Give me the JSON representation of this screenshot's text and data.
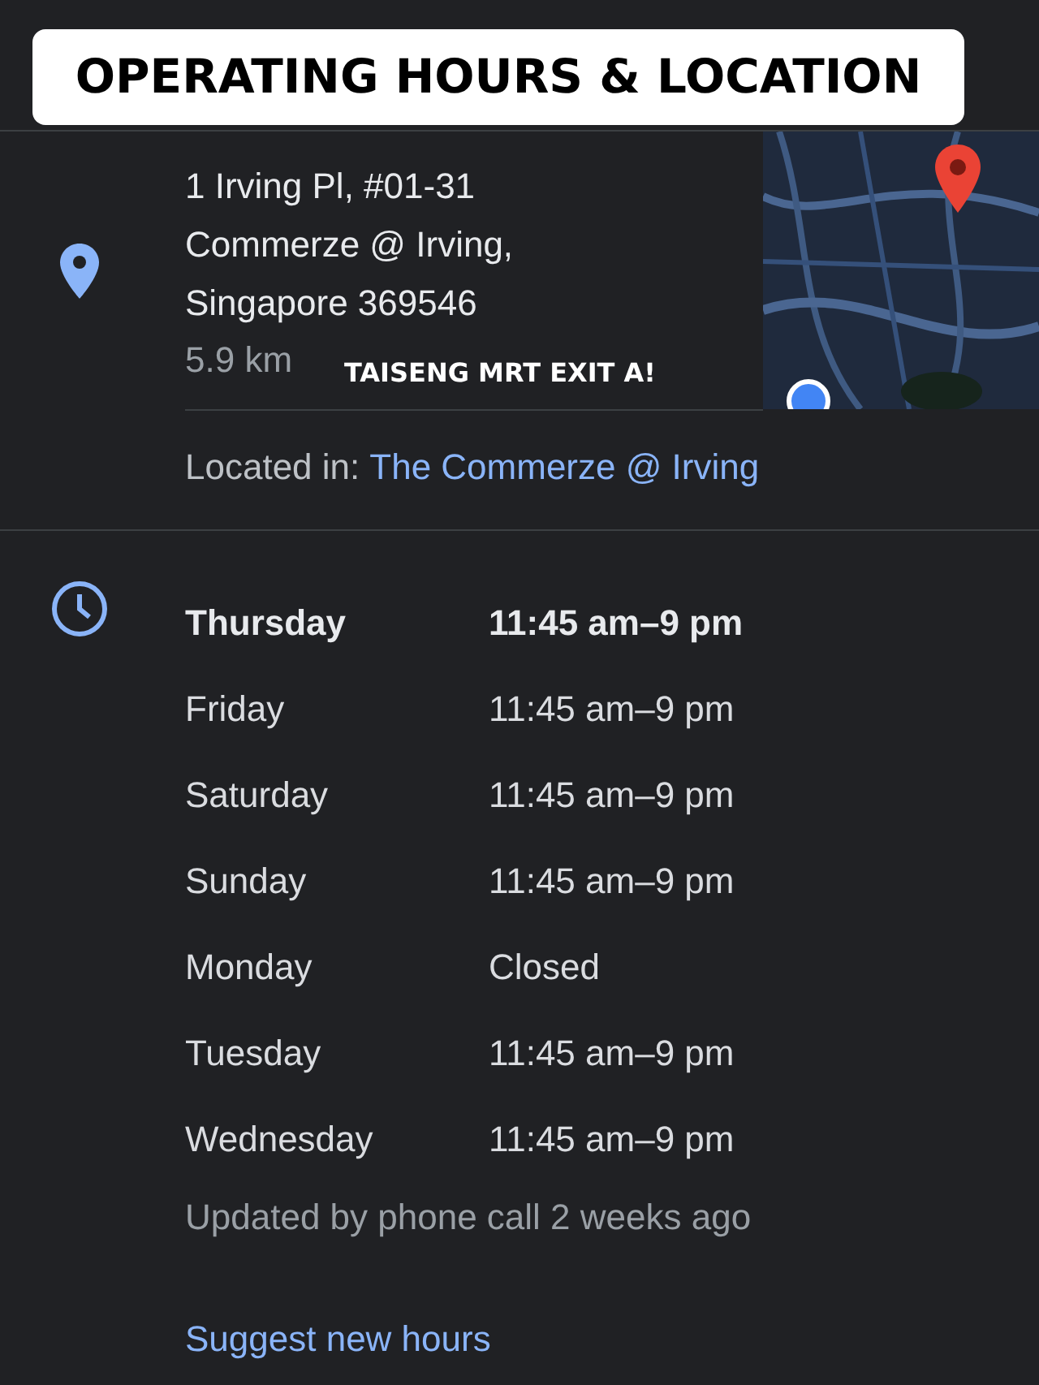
{
  "title": "OPERATING HOURS & LOCATION",
  "address": {
    "lines": [
      "1 Irving Pl, #01-31",
      "Commerze @ Irving,",
      "Singapore 369546"
    ],
    "distance": "5.9 km",
    "note": "TAISENG MRT EXIT A!"
  },
  "located_in": {
    "label": "Located in:",
    "link": "The Commerze @ Irving"
  },
  "hours": [
    {
      "day": "Thursday",
      "time": "11:45 am–9 pm",
      "today": true
    },
    {
      "day": "Friday",
      "time": "11:45 am–9 pm",
      "today": false
    },
    {
      "day": "Saturday",
      "time": "11:45 am–9 pm",
      "today": false
    },
    {
      "day": "Sunday",
      "time": "11:45 am–9 pm",
      "today": false
    },
    {
      "day": "Monday",
      "time": "Closed",
      "today": false
    },
    {
      "day": "Tuesday",
      "time": "11:45 am–9 pm",
      "today": false
    },
    {
      "day": "Wednesday",
      "time": "11:45 am–9 pm",
      "today": false
    }
  ],
  "updated": "Updated by phone call 2 weeks ago",
  "suggest_link": "Suggest new hours"
}
